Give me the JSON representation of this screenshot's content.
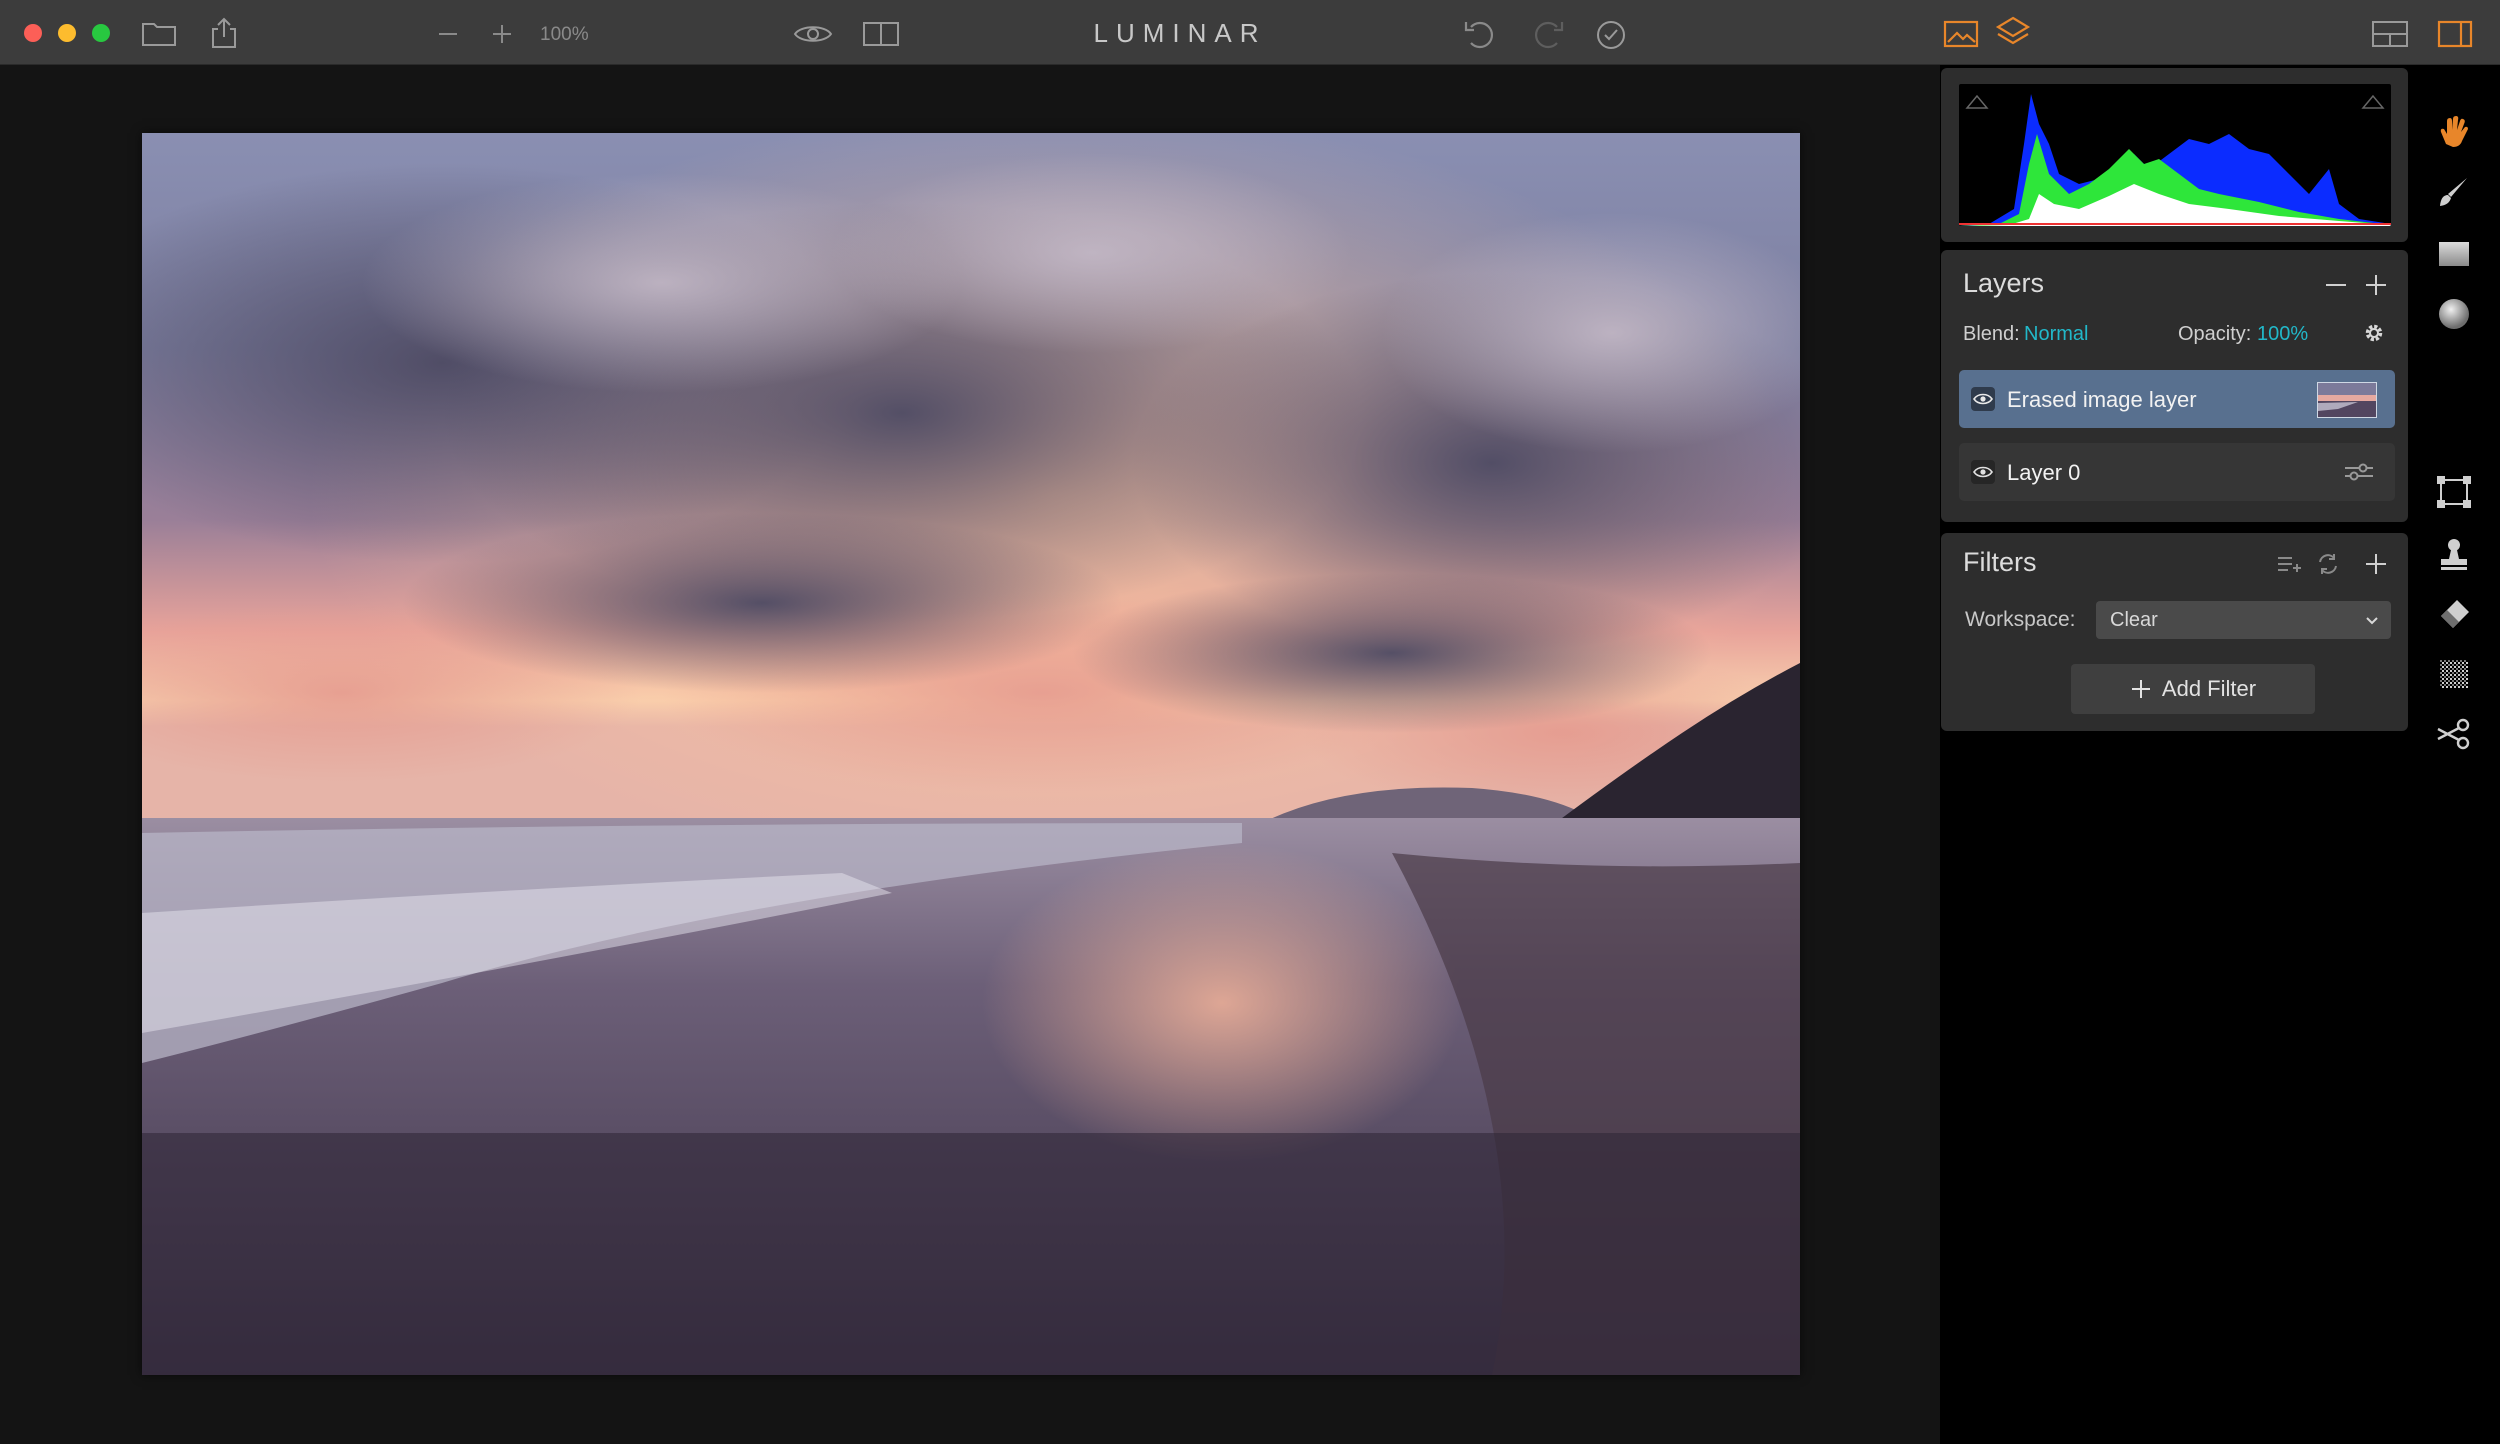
{
  "app": {
    "title": "LUMINAR"
  },
  "toolbar": {
    "zoom_level": "100%"
  },
  "layers": {
    "title": "Layers",
    "blend_label": "Blend:",
    "blend_value": "Normal",
    "opacity_label": "Opacity:",
    "opacity_value": "100%",
    "items": [
      {
        "name": "Erased image layer",
        "selected": true
      },
      {
        "name": "Layer 0",
        "selected": false
      }
    ]
  },
  "filters": {
    "title": "Filters",
    "workspace_label": "Workspace:",
    "workspace_value": "Clear",
    "add_filter_label": "Add Filter"
  },
  "colors": {
    "accent_orange": "#e8862a",
    "teal": "#22b8c9",
    "selected_layer": "#58708f",
    "panel": "#2d2d2d",
    "topbar": "#3c3c3c"
  },
  "tools": [
    "hand-icon",
    "brush-icon",
    "gradient-icon",
    "radial-icon",
    "transform-icon",
    "clone-stamp-icon",
    "eraser-icon",
    "noise-icon",
    "crop-icon"
  ]
}
